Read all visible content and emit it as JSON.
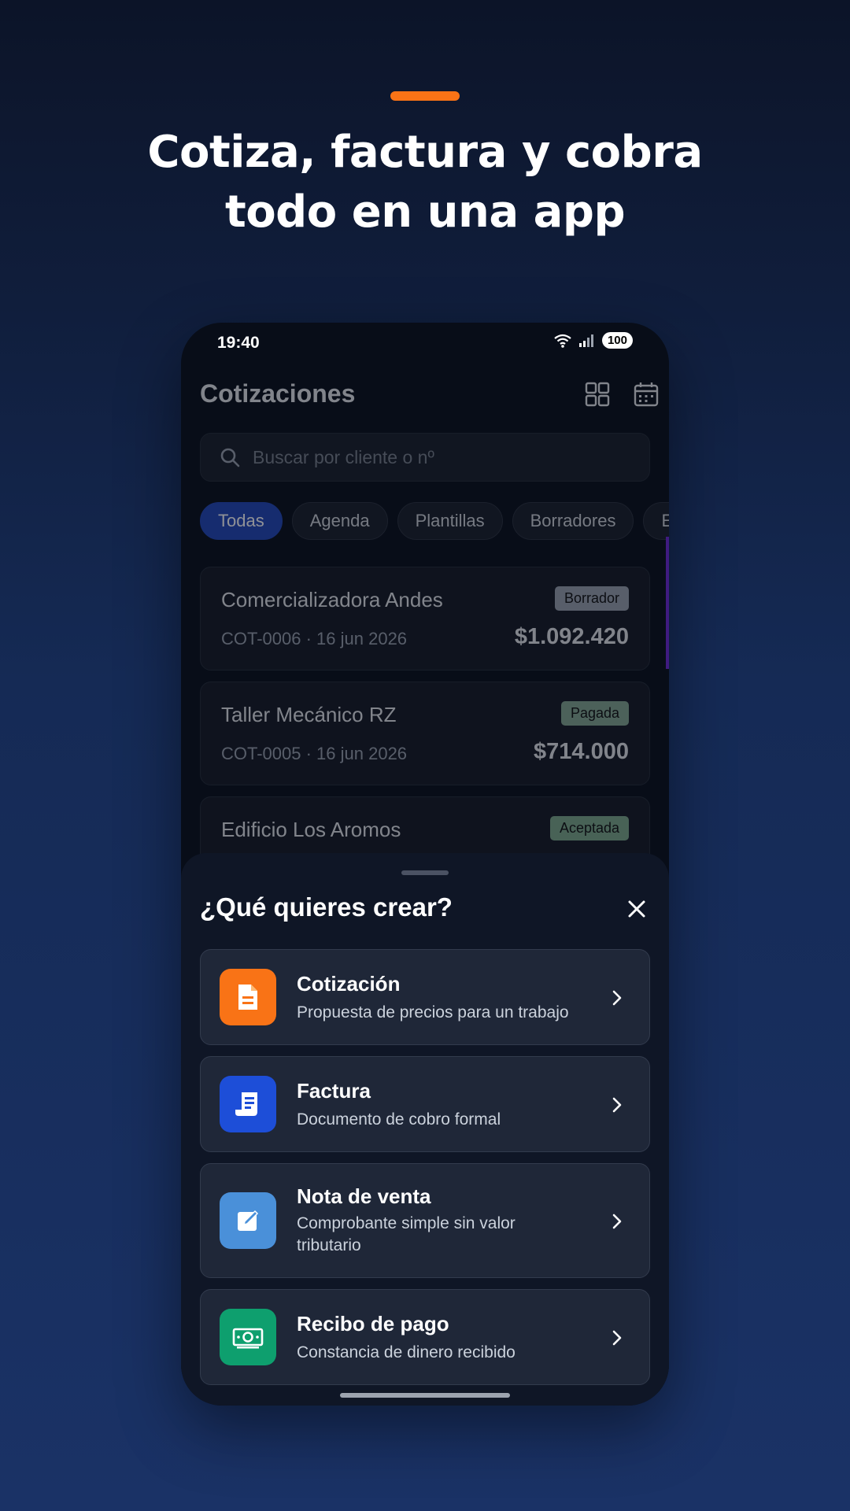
{
  "headline": {
    "line1": "Cotiza, factura y cobra",
    "line2": "todo en una app"
  },
  "colors": {
    "accent": "#f97316",
    "chip_active": "#2447b8",
    "badge_borrador": "#9ca3af",
    "badge_pagada": "#86a892",
    "badge_aceptada": "#7fa98a"
  },
  "status_bar": {
    "time": "19:40",
    "battery": "100"
  },
  "app": {
    "title": "Cotizaciones",
    "icons": [
      "grid-icon",
      "calendar-icon"
    ],
    "search": {
      "placeholder": "Buscar por cliente o nº",
      "value": ""
    },
    "chips": [
      {
        "label": "Todas",
        "active": true
      },
      {
        "label": "Agenda",
        "active": false
      },
      {
        "label": "Plantillas",
        "active": false
      },
      {
        "label": "Borradores",
        "active": false
      },
      {
        "label": "E",
        "active": false
      }
    ],
    "quotes": [
      {
        "client": "Comercializadora Andes",
        "meta": "COT-0006 · 16 jun 2026",
        "amount": "$1.092.420",
        "status": "Borrador"
      },
      {
        "client": "Taller Mecánico RZ",
        "meta": "COT-0005 · 16 jun 2026",
        "amount": "$714.000",
        "status": "Pagada"
      },
      {
        "client": "Edificio Los Aromos",
        "meta": "",
        "amount": "",
        "status": "Aceptada"
      }
    ]
  },
  "sheet": {
    "title": "¿Qué quieres crear?",
    "options": [
      {
        "title": "Cotización",
        "desc": "Propuesta de precios para un trabajo",
        "icon": "document-icon",
        "color": "#f97316"
      },
      {
        "title": "Factura",
        "desc": "Documento de cobro formal",
        "icon": "receipt-icon",
        "color": "#1d4ed8"
      },
      {
        "title": "Nota de venta",
        "desc": "Comprobante simple sin valor tributario",
        "icon": "edit-note-icon",
        "color": "#4a90d9"
      },
      {
        "title": "Recibo de pago",
        "desc": "Constancia de dinero recibido",
        "icon": "cash-icon",
        "color": "#0e9f6e"
      }
    ]
  }
}
